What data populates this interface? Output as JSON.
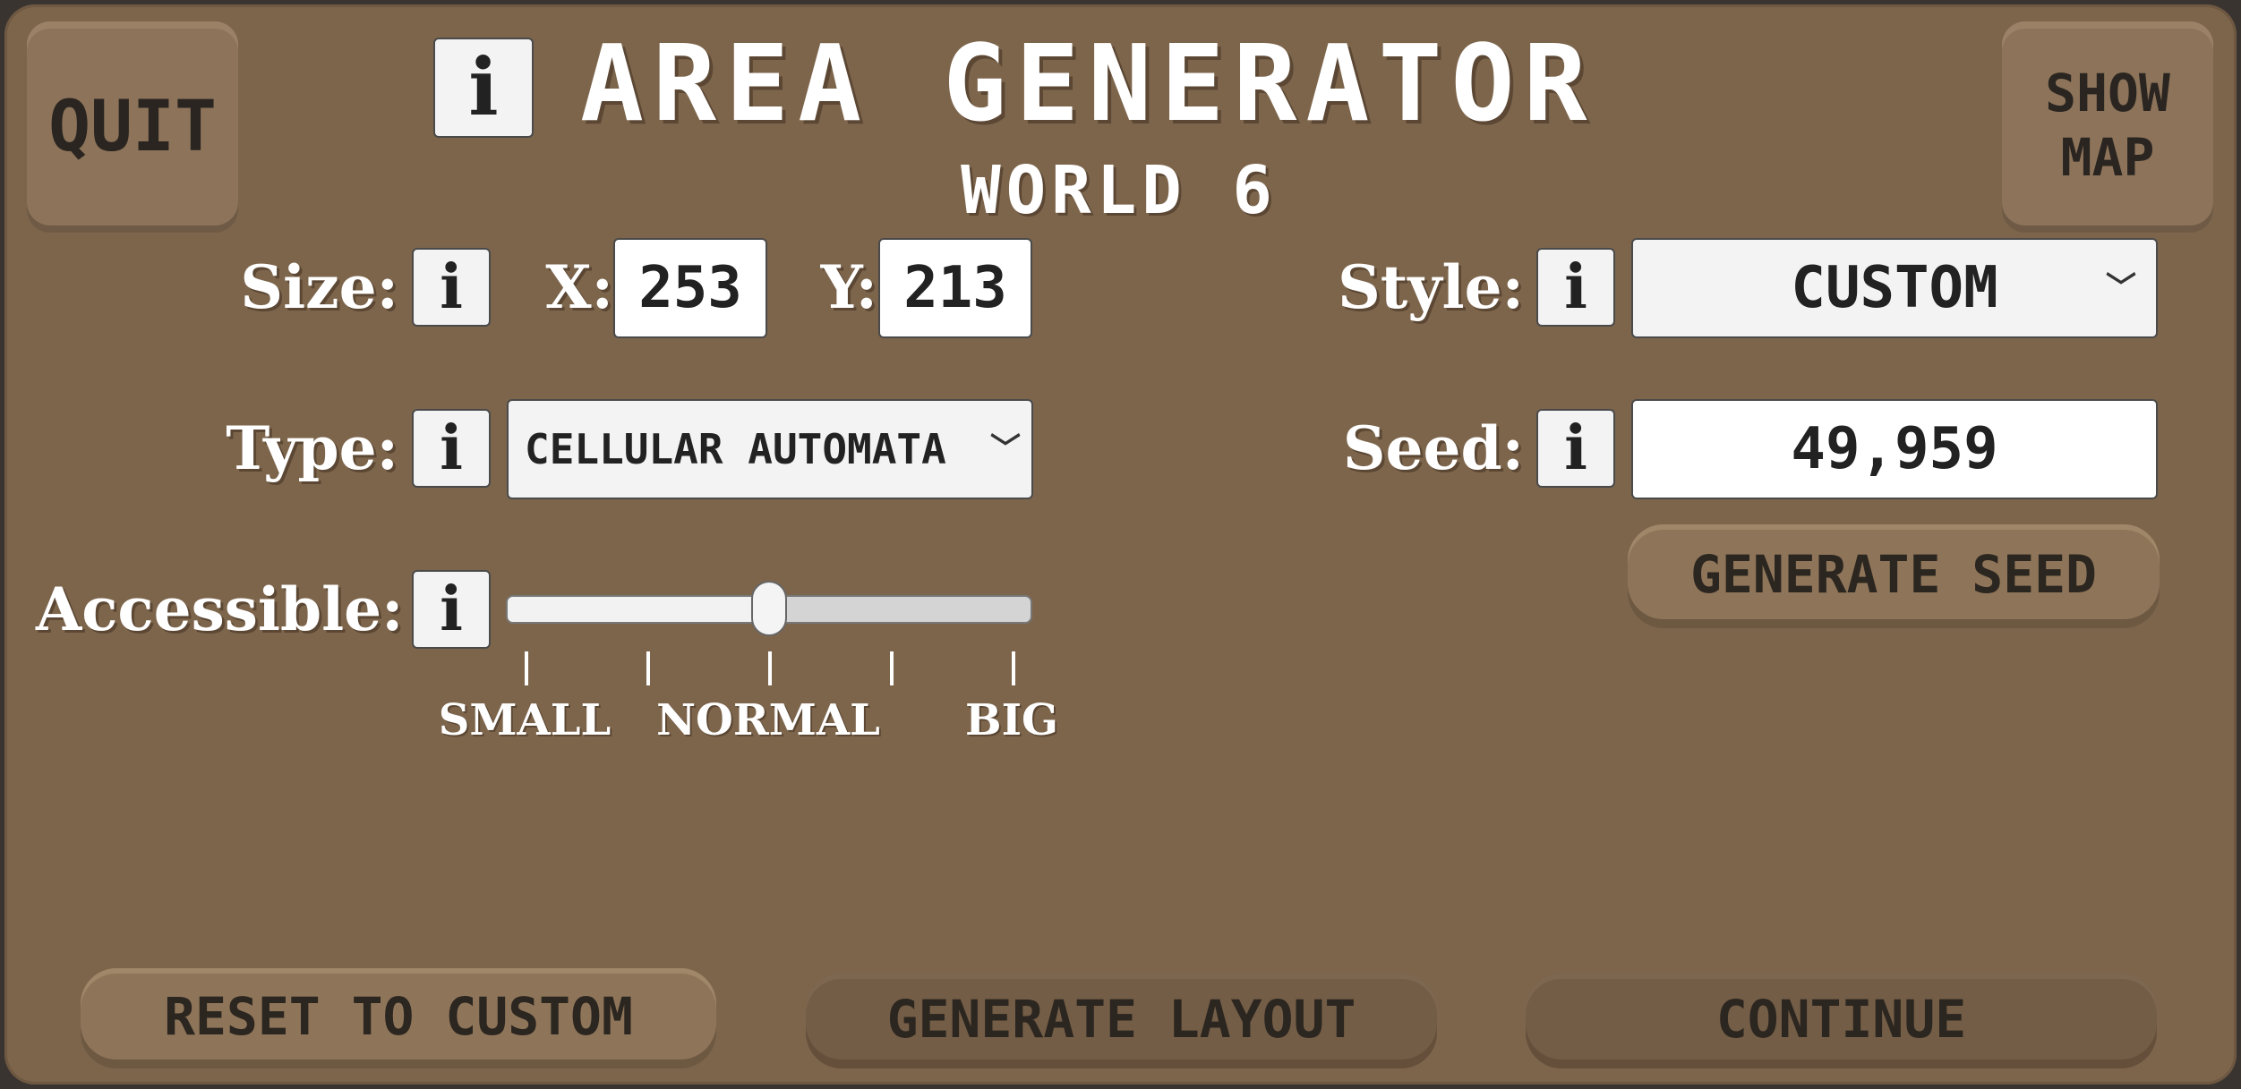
{
  "header": {
    "title": "AREA GENERATOR",
    "subtitle": "WORLD 6",
    "info_label": "i",
    "quit_label": "QUIT",
    "show_map_line1": "SHOW",
    "show_map_line2": "MAP"
  },
  "size": {
    "label": "Size:",
    "info_label": "i",
    "x_label": "X:",
    "x_value": "253",
    "y_label": "Y:",
    "y_value": "213"
  },
  "style": {
    "label": "Style:",
    "info_label": "i",
    "selected": "CUSTOM"
  },
  "type": {
    "label": "Type:",
    "info_label": "i",
    "selected": "CELLULAR AUTOMATA"
  },
  "seed": {
    "label": "Seed:",
    "info_label": "i",
    "value": "49,959",
    "generate_label": "GENERATE SEED"
  },
  "accessible": {
    "label": "Accessible:",
    "info_label": "i",
    "value_fraction": 0.5,
    "tick_count": 5,
    "tick_labels": {
      "small": "SMALL",
      "normal": "NORMAL",
      "big": "BIG"
    }
  },
  "footer": {
    "reset_label": "RESET TO CUSTOM",
    "generate_layout_label": "GENERATE LAYOUT",
    "continue_label": "CONTINUE"
  },
  "colors": {
    "panel": "#7d654c",
    "text": "#ffffff",
    "button": "#8e7559",
    "button_dark": "#735d46"
  }
}
